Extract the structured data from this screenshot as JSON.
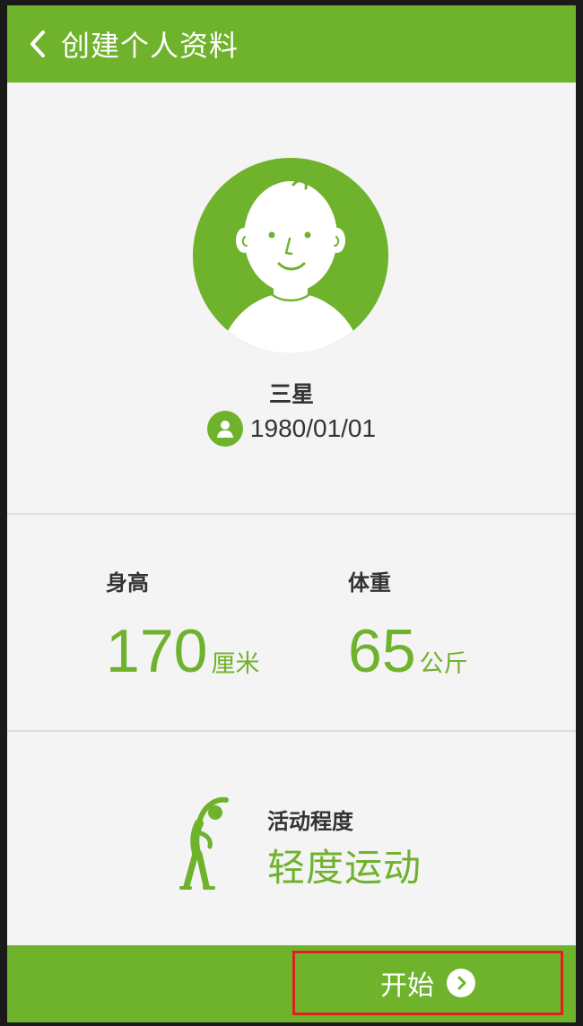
{
  "header": {
    "title": "创建个人资料",
    "back_icon": "chevron-left-icon"
  },
  "profile": {
    "avatar_icon": "user-avatar-icon",
    "name": "三星",
    "birthdate_icon": "user-icon",
    "birthdate": "1980/01/01"
  },
  "stats": {
    "height": {
      "label": "身高",
      "value": "170",
      "unit": "厘米"
    },
    "weight": {
      "label": "体重",
      "value": "65",
      "unit": "公斤"
    }
  },
  "activity": {
    "icon": "stretching-figure-icon",
    "label": "活动程度",
    "value": "轻度运动"
  },
  "footer": {
    "start_label": "开始",
    "start_icon": "chevron-right-circle-icon"
  },
  "colors": {
    "accent": "#6fb22c",
    "background": "#f4f4f4",
    "highlight_border": "#e02020"
  }
}
